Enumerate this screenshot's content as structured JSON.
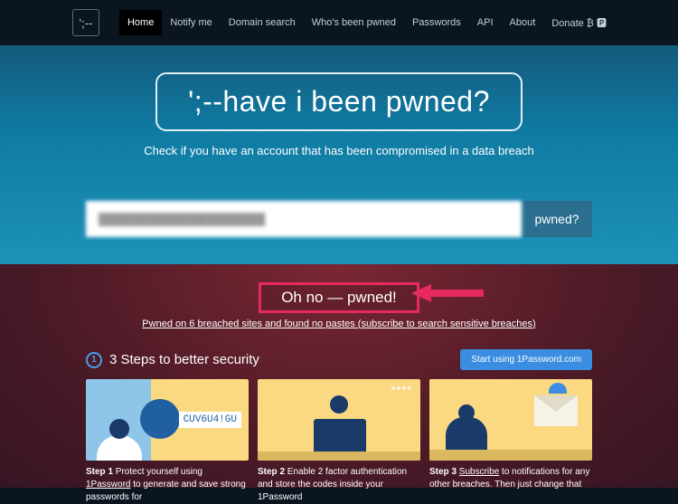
{
  "logo": "';--",
  "nav": {
    "items": [
      "Home",
      "Notify me",
      "Domain search",
      "Who's been pwned",
      "Passwords",
      "API",
      "About",
      "Donate ₿ 🅿"
    ],
    "active_index": 0
  },
  "hero": {
    "title": "';--have i been pwned?",
    "subtitle": "Check if you have an account that has been compromised in a data breach",
    "search_value": "████████████████████",
    "search_button": "pwned?"
  },
  "result": {
    "headline": "Oh no — pwned!",
    "detail_prefix": "Pwned on 6 breached sites and found no pastes (",
    "detail_link": "subscribe to search sensitive breaches",
    "detail_suffix": ")"
  },
  "steps": {
    "title": "3 Steps to better security",
    "cta": "Start using 1Password.com",
    "cards": [
      {
        "step": "Step 1",
        "link": "1Password",
        "text_before": "Protect yourself using ",
        "text_after": " to generate and save strong passwords for",
        "tag": "CUV6U4!GU"
      },
      {
        "step": "Step 2",
        "link": "",
        "text_before": "Enable 2 factor authentication and store the codes inside your 1Password",
        "text_after": ""
      },
      {
        "step": "Step 3",
        "link": "Subscribe",
        "text_before": "",
        "text_after": " to notifications for any other breaches. Then just change that"
      }
    ]
  }
}
